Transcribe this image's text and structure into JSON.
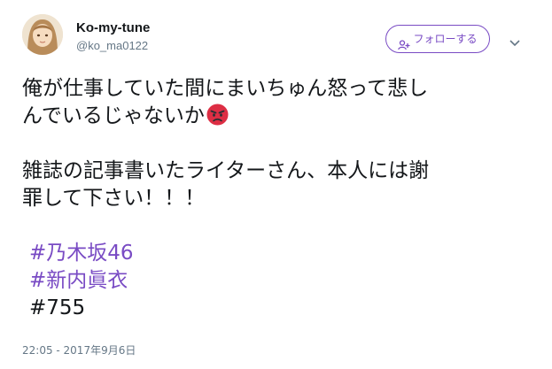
{
  "user": {
    "display_name": "Ko-my-tune",
    "handle": "@ko_ma0122"
  },
  "follow_button": {
    "label": "フォローする",
    "color": "#794bc4"
  },
  "tweet": {
    "lines": [
      "俺が仕事していた間にまいちゅん怒って悲し",
      "んでいるじゃないか",
      "雑誌の記事書いたライターさん、本人には謝",
      "罪して下さい！！！"
    ],
    "emoji": "angry-face",
    "hashtags": [
      "#乃木坂46",
      "#新内眞衣"
    ],
    "plain_tag": "#755"
  },
  "timestamp": "22:05 - 2017年9月6日",
  "colors": {
    "text": "#14171a",
    "secondary": "#657786",
    "hashtag": "#794bc4"
  }
}
